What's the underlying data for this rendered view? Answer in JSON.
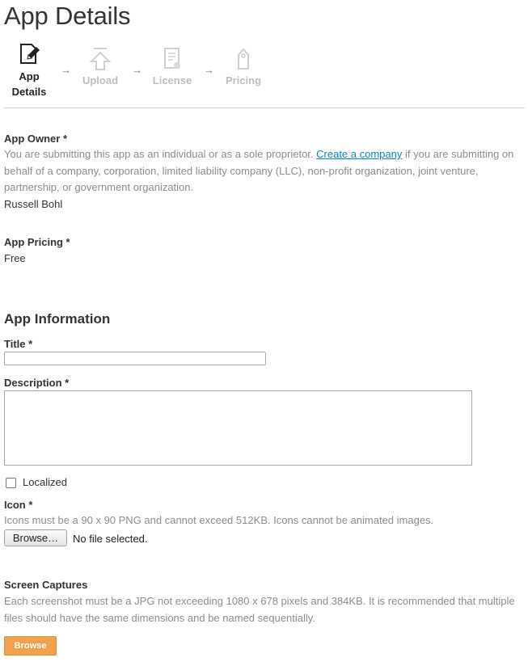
{
  "page": {
    "title": "App Details"
  },
  "steps": [
    {
      "label_line1": "App",
      "label_line2": "Details",
      "icon": "edit-document-icon",
      "active": true
    },
    {
      "label": "Upload",
      "icon": "upload-icon",
      "active": false
    },
    {
      "label": "License",
      "icon": "certificate-icon",
      "active": false
    },
    {
      "label": "Pricing",
      "icon": "price-tag-icon",
      "active": false
    }
  ],
  "step_arrow": "→",
  "owner": {
    "label": "App Owner *",
    "help_before": "You are submitting this app as an individual or as a sole proprietor. ",
    "help_link": "Create a company",
    "help_after": " if you are submitting on behalf of a company, corporation, limited liability company (LLC), non-profit organization, joint venture, partnership, or government organization.",
    "value": "Russell Bohl"
  },
  "pricing": {
    "label": "App Pricing *",
    "value": "Free"
  },
  "app_info": {
    "section_title": "App Information",
    "title_label": "Title *",
    "title_value": "",
    "description_label": "Description *",
    "description_value": "",
    "localized_label": "Localized",
    "localized_checked": false,
    "icon_label": "Icon *",
    "icon_help": "Icons must be a 90 x 90 PNG and cannot exceed 512KB. Icons cannot be animated images.",
    "browse_button": "Browse…",
    "file_status": "No file selected."
  },
  "screen_captures": {
    "label": "Screen Captures",
    "help": "Each screenshot must be a JPG not exceeding 1080 x 678 pixels and 384KB. It is recommended that multiple files should have the same dimensions and be named sequentially.",
    "browse_button": "Browse"
  },
  "colors": {
    "link": "#0a86c7",
    "accent_button": "#f2a24c",
    "help_text": "#8d8d8d"
  }
}
